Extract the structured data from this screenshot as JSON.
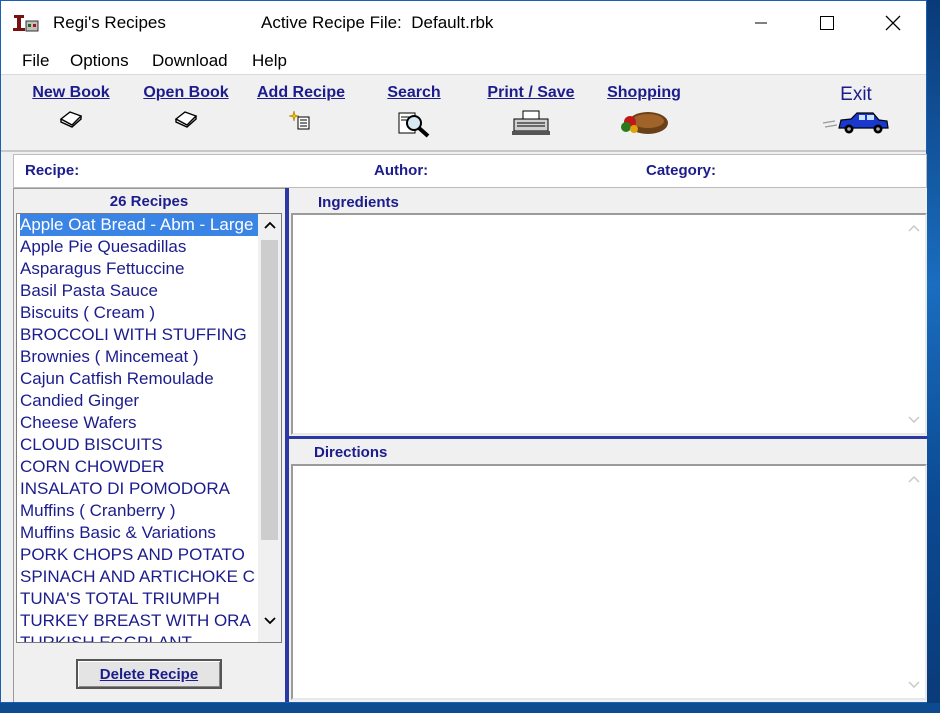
{
  "window": {
    "app_title": "Regi's Recipes",
    "active_file_label": "Active Recipe File:",
    "active_file": "Default.rbk",
    "controls": {
      "minimize": "minimize-icon",
      "maximize": "maximize-icon",
      "close": "close-icon"
    }
  },
  "menu": [
    "File",
    "Options",
    "Download",
    "Help"
  ],
  "toolbar": {
    "new_book": "New Book",
    "open_book": "Open Book",
    "add_recipe": "Add Recipe",
    "search": "Search",
    "print_save": "Print / Save",
    "shopping": "Shopping",
    "exit": "Exit"
  },
  "info": {
    "recipe_label": "Recipe:",
    "author_label": "Author:",
    "category_label": "Category:"
  },
  "recipes": {
    "count_label": "26 Recipes",
    "items": [
      "Apple Oat Bread - Abm - Large",
      "Apple Pie Quesadillas",
      "Asparagus Fettuccine",
      "Basil Pasta Sauce",
      "Biscuits ( Cream )",
      "BROCCOLI WITH STUFFING",
      "Brownies ( Mincemeat )",
      "Cajun Catfish Remoulade",
      "Candied Ginger",
      "Cheese Wafers",
      "CLOUD BISCUITS",
      "CORN CHOWDER",
      "INSALATO DI POMODORA",
      "Muffins ( Cranberry )",
      "Muffins Basic & Variations",
      "PORK CHOPS AND POTATO",
      "SPINACH AND ARTICHOKE C",
      "TUNA'S TOTAL TRIUMPH",
      "TURKEY BREAST WITH ORA",
      "TURKISH EGGPLANT"
    ],
    "selected": "Apple Oat Bread - Abm - Large",
    "delete_label": "Delete Recipe"
  },
  "sections": {
    "ingredients": "Ingredients",
    "directions": "Directions"
  },
  "colors": {
    "accent": "#1c1c8c",
    "selection": "#3a84e6",
    "divider": "#2a3aa0"
  }
}
